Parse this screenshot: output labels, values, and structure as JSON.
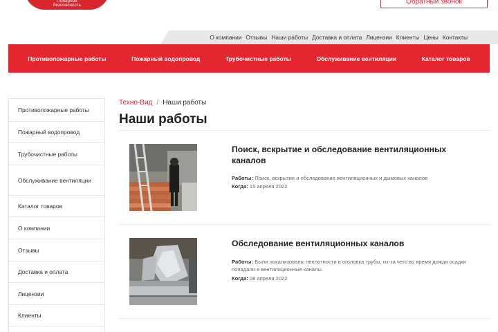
{
  "header": {
    "logo_text": "Пожарная\nбезопасность",
    "callback_label": "Обратный звонок"
  },
  "toplinks": [
    "О компании",
    "Отзывы",
    "Наши работы",
    "Доставка и оплата",
    "Лицензии",
    "Клиенты",
    "Цены",
    "Контакты"
  ],
  "mainnav": [
    "Противопожарные работы",
    "Пожарный водопровод",
    "Трубочистные работы",
    "Обслуживание вентиляции",
    "Каталог товаров"
  ],
  "sidebar": [
    "Противопожарные работы",
    "Пожарный водопровод",
    "Трубочистные работы",
    "Обслуживание вентиляции",
    "Каталог товаров",
    "О компании",
    "Отзывы",
    "Доставка и оплата",
    "Лицензии",
    "Клиенты"
  ],
  "breadcrumb": {
    "home": "Техно-Вид",
    "separator": "/",
    "current": "Наши работы"
  },
  "page_title": "Наши работы",
  "articles": [
    {
      "title": "Поиск, вскрытие и обследование вентиляционных каналов",
      "works_label": "Работы:",
      "works_text": "Поиск, вскрытие и обследование вентиляционных и дымовых каналов",
      "date_label": "Когда:",
      "date_text": "15 апреля 2022"
    },
    {
      "title": "Обследование вентиляционных каналов",
      "works_label": "Работы:",
      "works_text": "Были локализованы неплотности в оголовка трубы, из-за чего во время дождя осадки попадали в вентиляционные каналы.",
      "date_label": "Когда:",
      "date_text": "08 апреля 2022"
    }
  ],
  "colors": {
    "brand_red": "#e3262f",
    "text_dark": "#222222",
    "border": "#e4e4e4"
  }
}
